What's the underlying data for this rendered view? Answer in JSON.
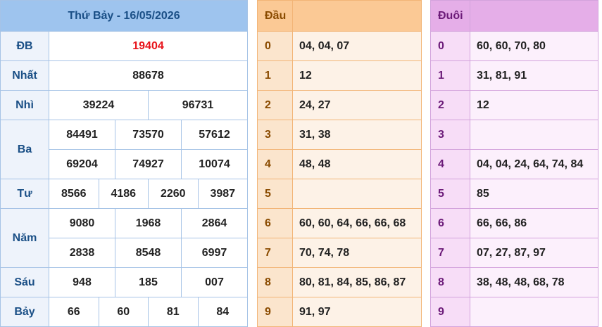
{
  "results": {
    "title": "Thứ Bảy - 16/05/2026",
    "colors": {
      "special": "#e8141b",
      "header_bg": "#9ec4ee",
      "label": "#1a4f86"
    },
    "prizes": [
      {
        "name": "ĐB",
        "rows": [
          [
            "19404"
          ]
        ]
      },
      {
        "name": "Nhất",
        "rows": [
          [
            "88678"
          ]
        ]
      },
      {
        "name": "Nhì",
        "rows": [
          [
            "39224",
            "96731"
          ]
        ]
      },
      {
        "name": "Ba",
        "rows": [
          [
            "84491",
            "73570",
            "57612"
          ],
          [
            "69204",
            "74927",
            "10074"
          ]
        ]
      },
      {
        "name": "Tư",
        "rows": [
          [
            "8566",
            "4186",
            "2260",
            "3987"
          ]
        ]
      },
      {
        "name": "Năm",
        "rows": [
          [
            "9080",
            "1968",
            "2864"
          ],
          [
            "2838",
            "8548",
            "6997"
          ]
        ]
      },
      {
        "name": "Sáu",
        "rows": [
          [
            "948",
            "185",
            "007"
          ]
        ]
      },
      {
        "name": "Bảy",
        "rows": [
          [
            "66",
            "60",
            "81",
            "84"
          ]
        ]
      }
    ]
  },
  "dau": {
    "header": "Đầu",
    "rows": [
      {
        "digit": "0",
        "values": "04, 04, 07"
      },
      {
        "digit": "1",
        "values": "12"
      },
      {
        "digit": "2",
        "values": "24, 27"
      },
      {
        "digit": "3",
        "values": "31, 38"
      },
      {
        "digit": "4",
        "values": "48, 48"
      },
      {
        "digit": "5",
        "values": ""
      },
      {
        "digit": "6",
        "values": "60, 60, 64, 66, 66, 68"
      },
      {
        "digit": "7",
        "values": "70, 74, 78"
      },
      {
        "digit": "8",
        "values": "80, 81, 84, 85, 86, 87"
      },
      {
        "digit": "9",
        "values": "91, 97"
      }
    ]
  },
  "duoi": {
    "header": "Đuôi",
    "rows": [
      {
        "digit": "0",
        "values": "60, 60, 70, 80"
      },
      {
        "digit": "1",
        "values": "31, 81, 91"
      },
      {
        "digit": "2",
        "values": "12"
      },
      {
        "digit": "3",
        "values": ""
      },
      {
        "digit": "4",
        "values": "04, 04, 24, 64, 74, 84"
      },
      {
        "digit": "5",
        "values": "85"
      },
      {
        "digit": "6",
        "values": "66, 66, 86"
      },
      {
        "digit": "7",
        "values": "07, 27, 87, 97"
      },
      {
        "digit": "8",
        "values": "38, 48, 48, 68, 78"
      },
      {
        "digit": "9",
        "values": ""
      }
    ]
  }
}
